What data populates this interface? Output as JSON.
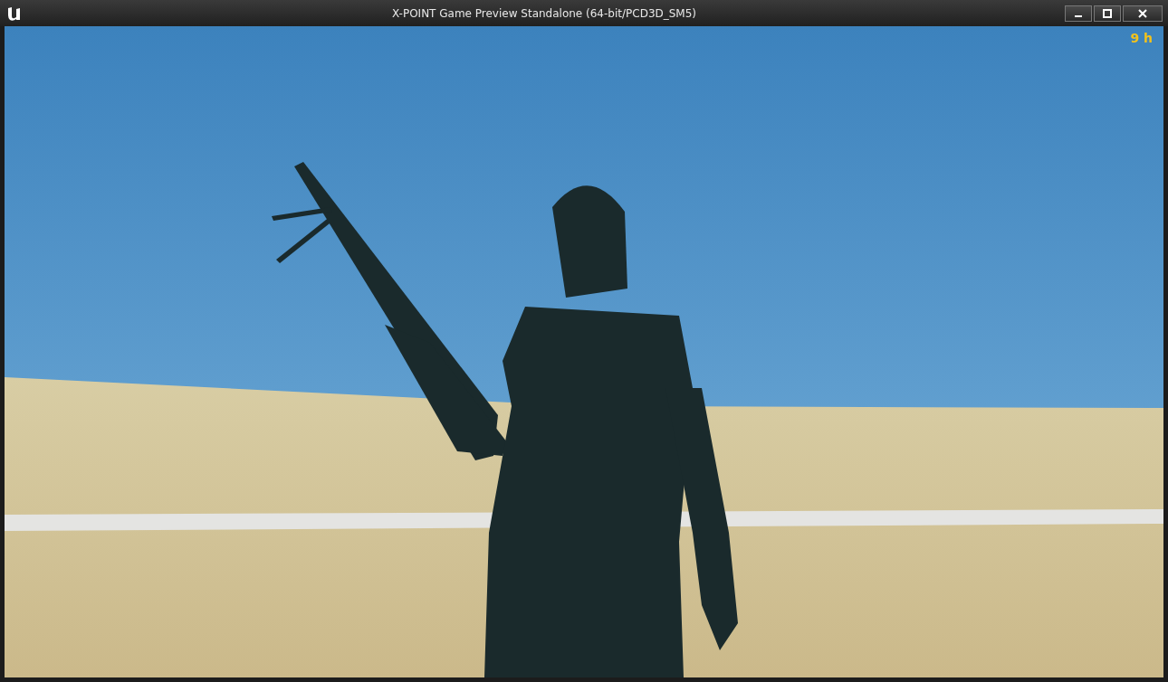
{
  "window": {
    "title": "X-POINT Game Preview Standalone (64-bit/PCD3D_SM5)"
  },
  "hud": {
    "time": "9 h"
  }
}
